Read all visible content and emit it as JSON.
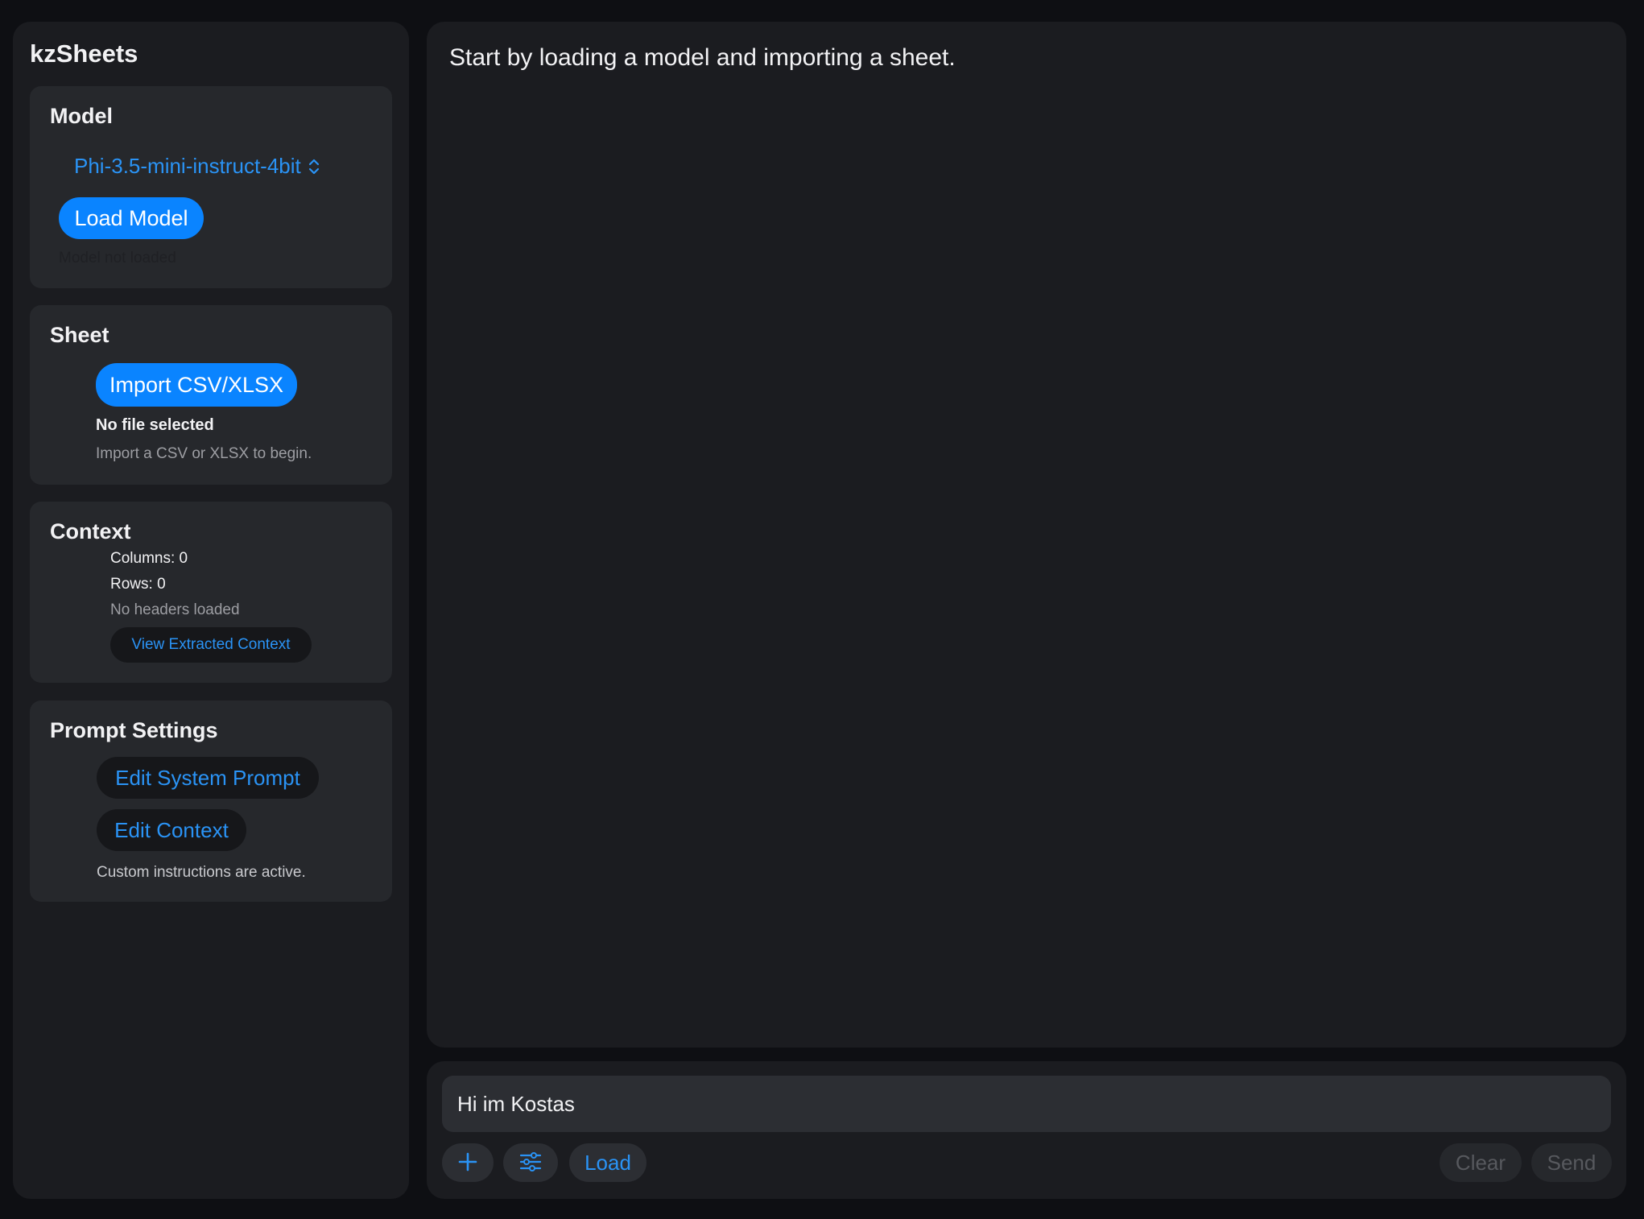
{
  "app": {
    "title": "kzSheets"
  },
  "model": {
    "heading": "Model",
    "selected_model": "Phi-3.5-mini-instruct-4bit",
    "load_label": "Load Model",
    "status": "Model not loaded"
  },
  "sheet": {
    "heading": "Sheet",
    "import_label": "Import CSV/XLSX",
    "file_status": "No file selected",
    "hint": "Import a CSV or XLSX to begin."
  },
  "context": {
    "heading": "Context",
    "columns": "Columns: 0",
    "rows": "Rows: 0",
    "headers": "No headers loaded",
    "view_label": "View Extracted Context"
  },
  "prompt_settings": {
    "heading": "Prompt Settings",
    "edit_system_label": "Edit System Prompt",
    "edit_context_label": "Edit Context",
    "status": "Custom instructions are active."
  },
  "main": {
    "message": "Start by loading a model and importing a sheet."
  },
  "composer": {
    "input_value": "Hi im Kostas",
    "add_icon": "plus-icon",
    "settings_icon": "sliders-icon",
    "load_label": "Load",
    "clear_label": "Clear",
    "send_label": "Send"
  },
  "colors": {
    "accent": "#0a84ff",
    "link": "#2a93f5",
    "panel": "#1b1c20",
    "card": "#26282c"
  }
}
